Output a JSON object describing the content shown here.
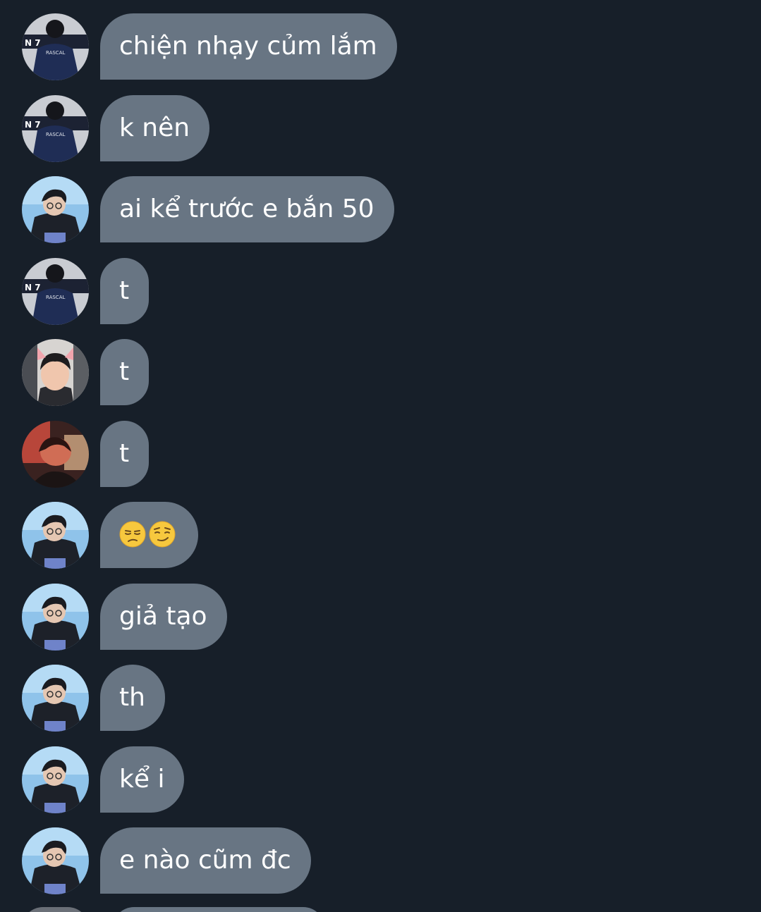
{
  "messages": [
    {
      "avatar": "rascal-jacket-avatar",
      "text": "chiện nhạy củm lắm"
    },
    {
      "avatar": "rascal-jacket-avatar",
      "text": "k nên"
    },
    {
      "avatar": "glasses-blue-avatar",
      "text": "ai kể trước e bắn 50"
    },
    {
      "avatar": "rascal-jacket-avatar",
      "text": "t"
    },
    {
      "avatar": "cat-ears-avatar",
      "text": "t"
    },
    {
      "avatar": "red-light-avatar",
      "text": "t"
    },
    {
      "avatar": "glasses-blue-avatar",
      "emoji": [
        "unamused-face-emoji",
        "smirking-face-emoji"
      ]
    },
    {
      "avatar": "glasses-blue-avatar",
      "text": "giả tạo"
    },
    {
      "avatar": "glasses-blue-avatar",
      "text": "th"
    },
    {
      "avatar": "glasses-blue-avatar",
      "text": "kể i"
    },
    {
      "avatar": "glasses-blue-avatar",
      "text": "e nào cũm đc"
    }
  ],
  "rascal_label": "RASCAL",
  "colors": {
    "background": "#171f29",
    "bubble": "#687583",
    "text": "#ffffff"
  }
}
